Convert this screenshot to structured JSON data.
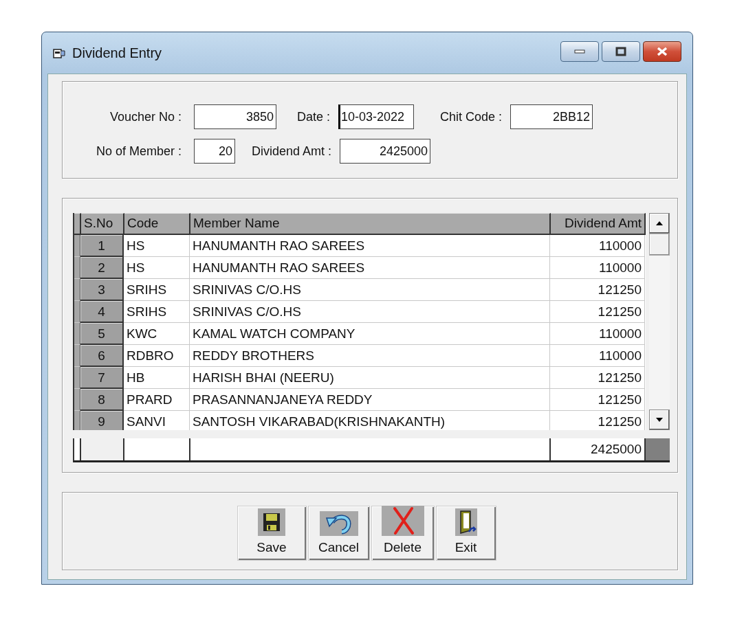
{
  "window": {
    "title": "Dividend Entry"
  },
  "form": {
    "rows": [
      [
        {
          "label": "Voucher No :",
          "value": "3850",
          "focused": false
        },
        {
          "label": "Date :",
          "value": "10-03-2022",
          "focused": true
        },
        {
          "label": "Chit Code :",
          "value": "2BB12",
          "focused": false
        }
      ],
      [
        {
          "label": "No of Member :",
          "value": "20",
          "focused": false
        },
        {
          "label": "Dividend Amt :",
          "value": "2425000",
          "focused": false
        }
      ]
    ]
  },
  "grid": {
    "columns": [
      "S.No",
      "Code",
      "Member Name",
      "Dividend Amt"
    ],
    "rows": [
      {
        "sno": "1",
        "code": "HS",
        "name": "HANUMANTH RAO SAREES",
        "amount": "110000"
      },
      {
        "sno": "2",
        "code": "HS",
        "name": "HANUMANTH RAO SAREES",
        "amount": "110000"
      },
      {
        "sno": "3",
        "code": "SRIHS",
        "name": "SRINIVAS C/O.HS",
        "amount": "121250"
      },
      {
        "sno": "4",
        "code": "SRIHS",
        "name": "SRINIVAS C/O.HS",
        "amount": "121250"
      },
      {
        "sno": "5",
        "code": "KWC",
        "name": "KAMAL WATCH COMPANY",
        "amount": "110000"
      },
      {
        "sno": "6",
        "code": "RDBRO",
        "name": "REDDY BROTHERS",
        "amount": "110000"
      },
      {
        "sno": "7",
        "code": "HB",
        "name": "HARISH BHAI (NEERU)",
        "amount": "121250"
      },
      {
        "sno": "8",
        "code": "PRARD",
        "name": "PRASANNANJANEYA REDDY",
        "amount": "121250"
      },
      {
        "sno": "9",
        "code": "SANVI",
        "name": "SANTOSH VIKARABAD(KRISHNAKANTH)",
        "amount": "121250"
      }
    ],
    "total": "2425000"
  },
  "buttons": [
    {
      "kind": "save",
      "label": "Save"
    },
    {
      "kind": "cancel",
      "label": "Cancel"
    },
    {
      "kind": "delete",
      "label": "Delete"
    },
    {
      "kind": "exit",
      "label": "Exit"
    }
  ]
}
